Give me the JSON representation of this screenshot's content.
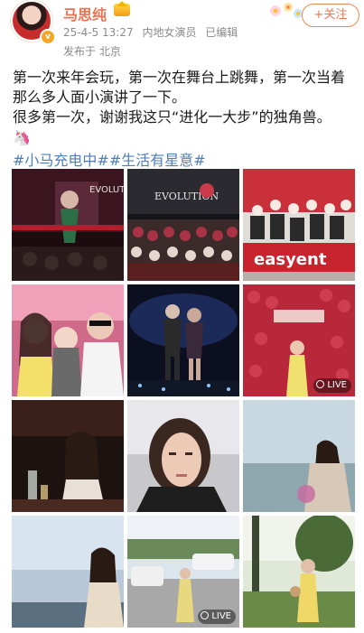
{
  "post": {
    "author_name": "马思纯",
    "date": "25-4-5 13:27",
    "source": "内地女演员",
    "edited": "已编辑",
    "location": "发布于 北京",
    "follow_label": "+关注",
    "text_line1": "第一次来年会玩，第一次在舞台上跳舞，第一次当着那么多人面小演讲了一下。",
    "text_line2": "很多第一次，谢谢我这只“进化一大步”的独角兽。",
    "emoji": "🦄",
    "tags": "#小马充电中##生活有星意#"
  },
  "photos": [
    {
      "desc": "stage-performance",
      "live": false,
      "overlay": "EVOLUT"
    },
    {
      "desc": "group-photo-stage",
      "live": false,
      "overlay": "EVOLUTION"
    },
    {
      "desc": "group-photo-easyent",
      "live": false,
      "overlay": "easyent"
    },
    {
      "desc": "selfie-trio",
      "live": false,
      "overlay": ""
    },
    {
      "desc": "dance-duo",
      "live": false,
      "overlay": ""
    },
    {
      "desc": "rose-wall",
      "live": true,
      "overlay": "LIVE"
    },
    {
      "desc": "dining-toast",
      "live": false,
      "overlay": ""
    },
    {
      "desc": "closeup-selfie",
      "live": false,
      "overlay": ""
    },
    {
      "desc": "lake-portrait",
      "live": false,
      "overlay": ""
    },
    {
      "desc": "sky-portrait",
      "live": false,
      "overlay": ""
    },
    {
      "desc": "car-road",
      "live": true,
      "overlay": "LIVE"
    },
    {
      "desc": "park-walk",
      "live": false,
      "overlay": ""
    }
  ],
  "colors": {
    "name": "#eb7350",
    "tag": "#4f7fb8",
    "meta": "#8a8a8a"
  }
}
